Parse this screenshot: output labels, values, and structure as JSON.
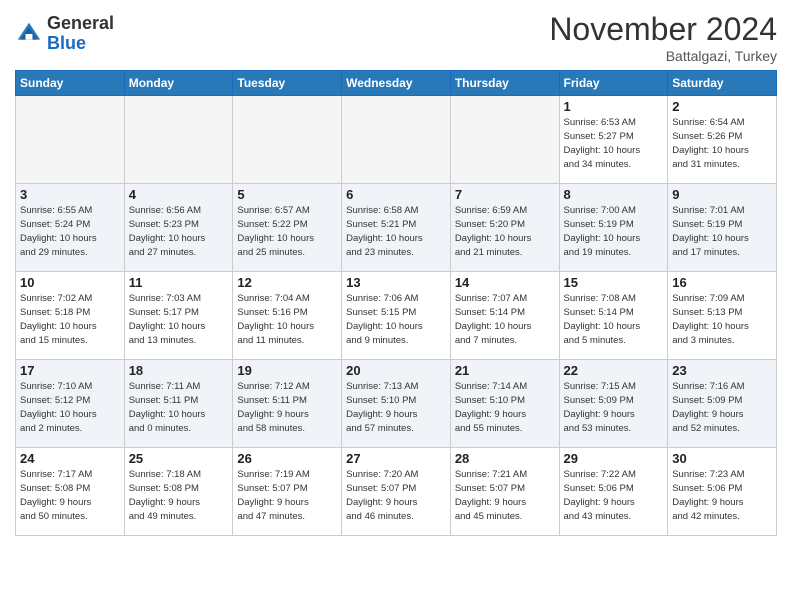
{
  "header": {
    "logo_line1": "General",
    "logo_line2": "Blue",
    "month": "November 2024",
    "location": "Battalgazi, Turkey"
  },
  "weekdays": [
    "Sunday",
    "Monday",
    "Tuesday",
    "Wednesday",
    "Thursday",
    "Friday",
    "Saturday"
  ],
  "weeks": [
    [
      {
        "day": "",
        "info": ""
      },
      {
        "day": "",
        "info": ""
      },
      {
        "day": "",
        "info": ""
      },
      {
        "day": "",
        "info": ""
      },
      {
        "day": "",
        "info": ""
      },
      {
        "day": "1",
        "info": "Sunrise: 6:53 AM\nSunset: 5:27 PM\nDaylight: 10 hours\nand 34 minutes."
      },
      {
        "day": "2",
        "info": "Sunrise: 6:54 AM\nSunset: 5:26 PM\nDaylight: 10 hours\nand 31 minutes."
      }
    ],
    [
      {
        "day": "3",
        "info": "Sunrise: 6:55 AM\nSunset: 5:24 PM\nDaylight: 10 hours\nand 29 minutes."
      },
      {
        "day": "4",
        "info": "Sunrise: 6:56 AM\nSunset: 5:23 PM\nDaylight: 10 hours\nand 27 minutes."
      },
      {
        "day": "5",
        "info": "Sunrise: 6:57 AM\nSunset: 5:22 PM\nDaylight: 10 hours\nand 25 minutes."
      },
      {
        "day": "6",
        "info": "Sunrise: 6:58 AM\nSunset: 5:21 PM\nDaylight: 10 hours\nand 23 minutes."
      },
      {
        "day": "7",
        "info": "Sunrise: 6:59 AM\nSunset: 5:20 PM\nDaylight: 10 hours\nand 21 minutes."
      },
      {
        "day": "8",
        "info": "Sunrise: 7:00 AM\nSunset: 5:19 PM\nDaylight: 10 hours\nand 19 minutes."
      },
      {
        "day": "9",
        "info": "Sunrise: 7:01 AM\nSunset: 5:19 PM\nDaylight: 10 hours\nand 17 minutes."
      }
    ],
    [
      {
        "day": "10",
        "info": "Sunrise: 7:02 AM\nSunset: 5:18 PM\nDaylight: 10 hours\nand 15 minutes."
      },
      {
        "day": "11",
        "info": "Sunrise: 7:03 AM\nSunset: 5:17 PM\nDaylight: 10 hours\nand 13 minutes."
      },
      {
        "day": "12",
        "info": "Sunrise: 7:04 AM\nSunset: 5:16 PM\nDaylight: 10 hours\nand 11 minutes."
      },
      {
        "day": "13",
        "info": "Sunrise: 7:06 AM\nSunset: 5:15 PM\nDaylight: 10 hours\nand 9 minutes."
      },
      {
        "day": "14",
        "info": "Sunrise: 7:07 AM\nSunset: 5:14 PM\nDaylight: 10 hours\nand 7 minutes."
      },
      {
        "day": "15",
        "info": "Sunrise: 7:08 AM\nSunset: 5:14 PM\nDaylight: 10 hours\nand 5 minutes."
      },
      {
        "day": "16",
        "info": "Sunrise: 7:09 AM\nSunset: 5:13 PM\nDaylight: 10 hours\nand 3 minutes."
      }
    ],
    [
      {
        "day": "17",
        "info": "Sunrise: 7:10 AM\nSunset: 5:12 PM\nDaylight: 10 hours\nand 2 minutes."
      },
      {
        "day": "18",
        "info": "Sunrise: 7:11 AM\nSunset: 5:11 PM\nDaylight: 10 hours\nand 0 minutes."
      },
      {
        "day": "19",
        "info": "Sunrise: 7:12 AM\nSunset: 5:11 PM\nDaylight: 9 hours\nand 58 minutes."
      },
      {
        "day": "20",
        "info": "Sunrise: 7:13 AM\nSunset: 5:10 PM\nDaylight: 9 hours\nand 57 minutes."
      },
      {
        "day": "21",
        "info": "Sunrise: 7:14 AM\nSunset: 5:10 PM\nDaylight: 9 hours\nand 55 minutes."
      },
      {
        "day": "22",
        "info": "Sunrise: 7:15 AM\nSunset: 5:09 PM\nDaylight: 9 hours\nand 53 minutes."
      },
      {
        "day": "23",
        "info": "Sunrise: 7:16 AM\nSunset: 5:09 PM\nDaylight: 9 hours\nand 52 minutes."
      }
    ],
    [
      {
        "day": "24",
        "info": "Sunrise: 7:17 AM\nSunset: 5:08 PM\nDaylight: 9 hours\nand 50 minutes."
      },
      {
        "day": "25",
        "info": "Sunrise: 7:18 AM\nSunset: 5:08 PM\nDaylight: 9 hours\nand 49 minutes."
      },
      {
        "day": "26",
        "info": "Sunrise: 7:19 AM\nSunset: 5:07 PM\nDaylight: 9 hours\nand 47 minutes."
      },
      {
        "day": "27",
        "info": "Sunrise: 7:20 AM\nSunset: 5:07 PM\nDaylight: 9 hours\nand 46 minutes."
      },
      {
        "day": "28",
        "info": "Sunrise: 7:21 AM\nSunset: 5:07 PM\nDaylight: 9 hours\nand 45 minutes."
      },
      {
        "day": "29",
        "info": "Sunrise: 7:22 AM\nSunset: 5:06 PM\nDaylight: 9 hours\nand 43 minutes."
      },
      {
        "day": "30",
        "info": "Sunrise: 7:23 AM\nSunset: 5:06 PM\nDaylight: 9 hours\nand 42 minutes."
      }
    ]
  ]
}
